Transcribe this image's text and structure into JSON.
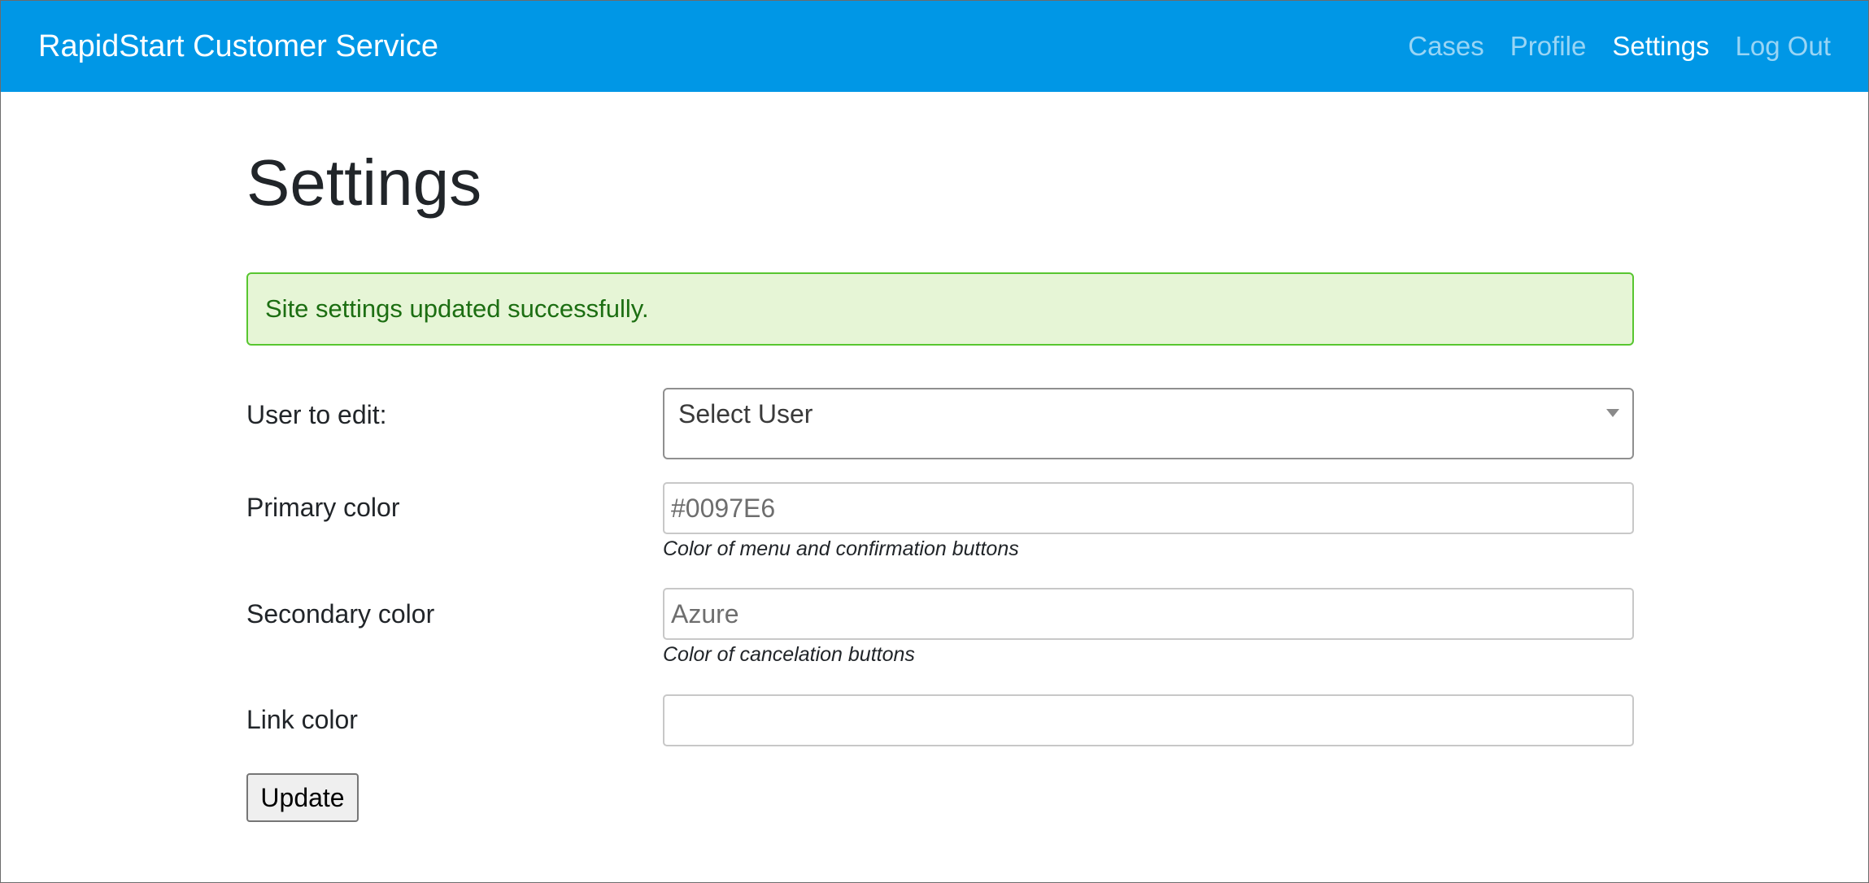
{
  "navbar": {
    "brand": "RapidStart Customer Service",
    "links": [
      {
        "label": "Cases",
        "active": false
      },
      {
        "label": "Profile",
        "active": false
      },
      {
        "label": "Settings",
        "active": true
      },
      {
        "label": "Log Out",
        "active": false
      }
    ],
    "background_color": "#0097E6"
  },
  "page": {
    "title": "Settings",
    "alert": "Site settings updated successfully."
  },
  "form": {
    "user_label": "User to edit:",
    "user_select_value": "Select User",
    "primary_label": "Primary color",
    "primary_value": "#0097E6",
    "primary_help": "Color of menu and confirmation buttons",
    "secondary_label": "Secondary color",
    "secondary_value": "Azure",
    "secondary_help": "Color of cancelation buttons",
    "link_label": "Link color",
    "link_value": "",
    "submit_label": "Update"
  }
}
